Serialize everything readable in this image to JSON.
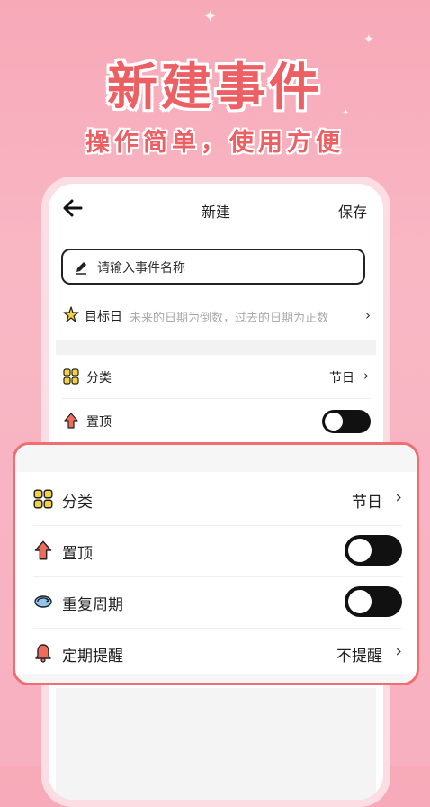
{
  "promo": {
    "headline": "新建事件",
    "subheadline": "操作简单，使用方便"
  },
  "topbar": {
    "back_icon": "arrow-left-icon",
    "title": "新建",
    "save_label": "保存"
  },
  "name_input": {
    "icon": "pencil-icon",
    "placeholder": "请输入事件名称",
    "value": ""
  },
  "target_date": {
    "icon": "star-icon",
    "label": "目标日",
    "hint": "未来的日期为倒数，过去的日期为正数",
    "chevron": "›"
  },
  "settings": {
    "category": {
      "icon": "grid-icon",
      "label": "分类",
      "value": "节日",
      "chevron": "›"
    },
    "pin": {
      "icon": "arrow-up-icon",
      "label": "置顶",
      "toggle": "off"
    },
    "repeat": {
      "icon": "cycle-icon",
      "label": "重复周期",
      "toggle": "off"
    },
    "reminder": {
      "icon": "bell-icon",
      "label": "定期提醒",
      "value": "不提醒",
      "chevron": "›"
    }
  },
  "colors": {
    "accent": "#ec5f63",
    "background": "#f7a9b8",
    "toggle_off": "#111111"
  }
}
